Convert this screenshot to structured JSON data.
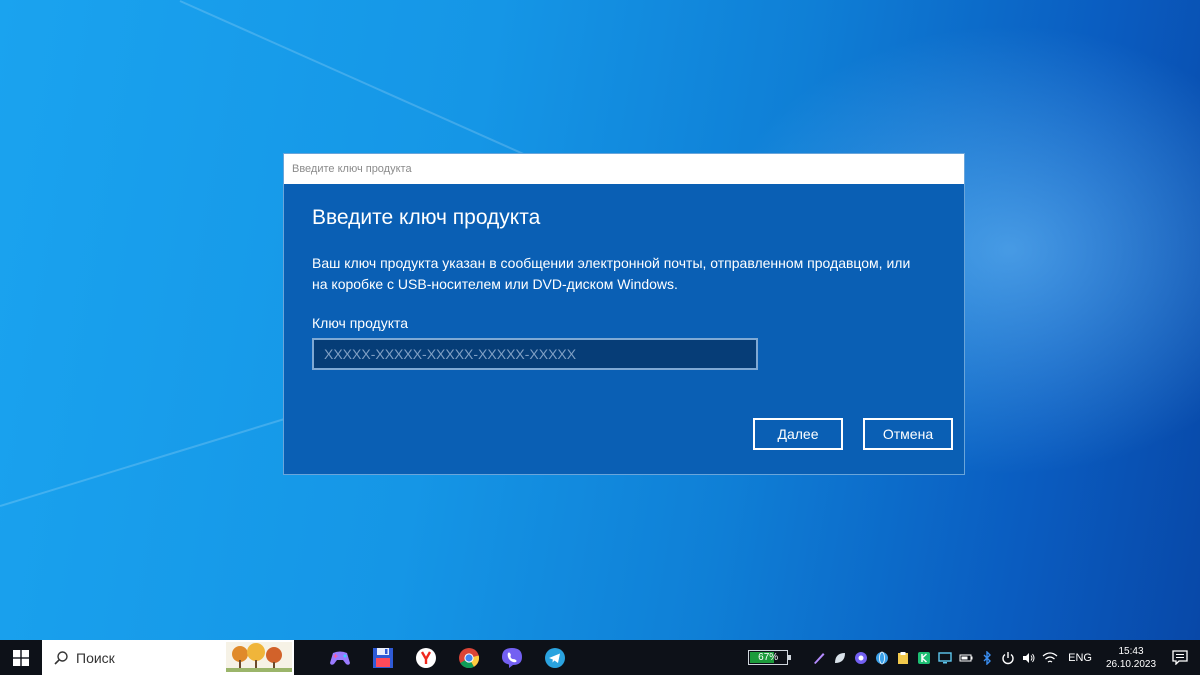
{
  "dialog": {
    "window_title": "Введите ключ продукта",
    "heading": "Введите ключ продукта",
    "description": "Ваш ключ продукта указан в сообщении электронной почты, отправленном продавцом, или на коробке с USB-носителем или DVD-диском Windows.",
    "key_label": "Ключ продукта",
    "key_value": "",
    "key_placeholder": "XXXXX-XXXXX-XXXXX-XXXXX-XXXXX",
    "next_label": "Далее",
    "cancel_label": "Отмена"
  },
  "taskbar": {
    "search_placeholder": "Поиск",
    "apps": [
      "gamepad-icon",
      "floppy-disk-icon",
      "yandex-browser-icon",
      "chrome-icon",
      "viber-icon",
      "telegram-icon"
    ],
    "battery_percent": 67,
    "battery_text": "67%",
    "tray_icons": [
      "pen-icon",
      "leaf-icon",
      "viber-tray-icon",
      "globe-icon",
      "clipboard-icon",
      "kaspersky-icon",
      "monitor-icon",
      "battery-tray-icon",
      "bluetooth-icon",
      "power-icon",
      "volume-icon",
      "wifi-icon"
    ],
    "language": "ENG",
    "time": "15:43",
    "date": "26.10.2023"
  },
  "colors": {
    "dialog_bg": "#0a5fb4",
    "input_bg": "#063d77",
    "taskbar_bg": "#0d1118",
    "battery_green": "#1c9b3b"
  }
}
